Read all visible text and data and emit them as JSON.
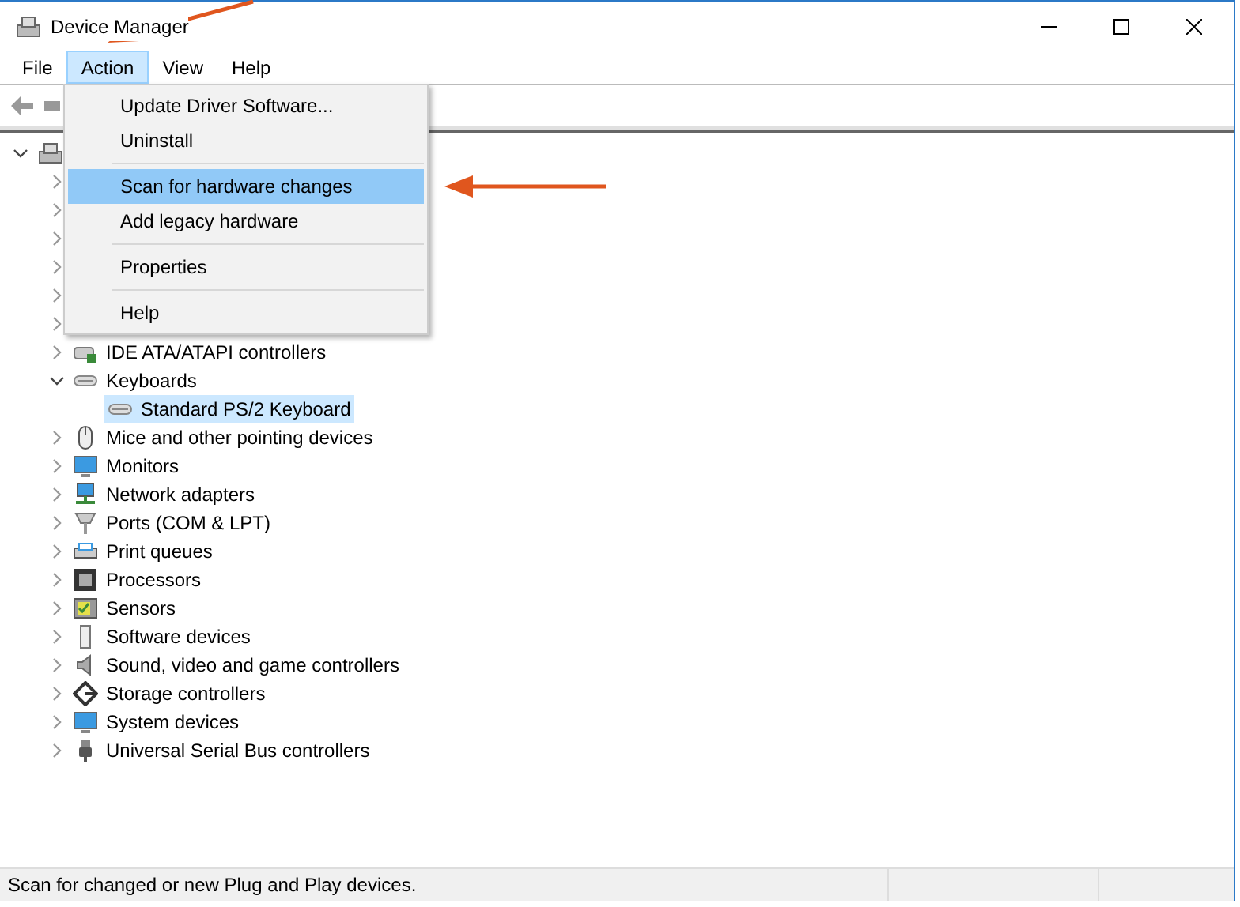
{
  "window": {
    "title": "Device Manager"
  },
  "menu_bar": [
    {
      "label": "File",
      "selected": false
    },
    {
      "label": "Action",
      "selected": true
    },
    {
      "label": "View",
      "selected": false
    },
    {
      "label": "Help",
      "selected": false
    }
  ],
  "action_menu": [
    {
      "kind": "item",
      "label": "Update Driver Software...",
      "selected": false
    },
    {
      "kind": "item",
      "label": "Uninstall",
      "selected": false
    },
    {
      "kind": "separator"
    },
    {
      "kind": "item",
      "label": "Scan for hardware changes",
      "selected": true
    },
    {
      "kind": "item",
      "label": "Add legacy hardware",
      "selected": false
    },
    {
      "kind": "separator"
    },
    {
      "kind": "item",
      "label": "Properties",
      "selected": false
    },
    {
      "kind": "separator"
    },
    {
      "kind": "item",
      "label": "Help",
      "selected": false
    }
  ],
  "tree": {
    "expanded": true,
    "children": [
      {
        "expanded": false
      },
      {
        "expanded": false
      },
      {
        "expanded": false
      },
      {
        "expanded": false
      },
      {
        "expanded": false
      },
      {
        "expanded": false
      },
      {
        "label": "IDE ATA/ATAPI controllers",
        "expanded": false
      },
      {
        "label": "Keyboards",
        "expanded": true,
        "children": [
          {
            "label": "Standard PS/2 Keyboard",
            "selected": true
          }
        ]
      },
      {
        "label": "Mice and other pointing devices",
        "expanded": false
      },
      {
        "label": "Monitors",
        "expanded": false
      },
      {
        "label": "Network adapters",
        "expanded": false
      },
      {
        "label": "Ports (COM & LPT)",
        "expanded": false
      },
      {
        "label": "Print queues",
        "expanded": false
      },
      {
        "label": "Processors",
        "expanded": false
      },
      {
        "label": "Sensors",
        "expanded": false
      },
      {
        "label": "Software devices",
        "expanded": false
      },
      {
        "label": "Sound, video and game controllers",
        "expanded": false
      },
      {
        "label": "Storage controllers",
        "expanded": false
      },
      {
        "label": "System devices",
        "expanded": false
      },
      {
        "label": "Universal Serial Bus controllers",
        "expanded": false
      }
    ]
  },
  "status_bar": {
    "text": "Scan for changed or new Plug and Play devices."
  }
}
